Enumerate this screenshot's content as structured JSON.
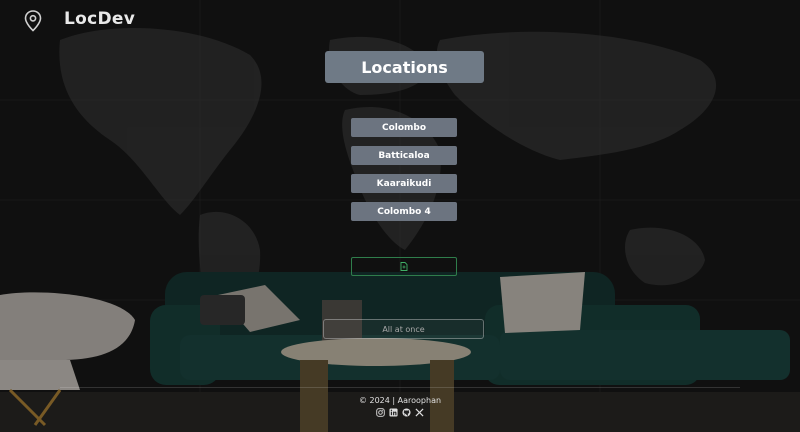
{
  "app": {
    "brand": "LocDev"
  },
  "icons": {
    "pin": "map-pin-icon",
    "export": "file-icon",
    "socials": [
      "instagram-icon",
      "linkedin-icon",
      "github-icon",
      "x-icon"
    ]
  },
  "main": {
    "title": "Locations",
    "locations": [
      {
        "label": "Colombo"
      },
      {
        "label": "Batticaloa"
      },
      {
        "label": "Kaaraikudi"
      },
      {
        "label": "Colombo 4"
      }
    ],
    "all_button": "All at once"
  },
  "footer": {
    "copyright": "© 2024 | Aaroophan"
  },
  "colors": {
    "background": "#141414",
    "title_box": "#6f7a86",
    "location_button": "#6c7480",
    "export_border": "#2f7d4b",
    "export_icon": "#3fae66"
  }
}
